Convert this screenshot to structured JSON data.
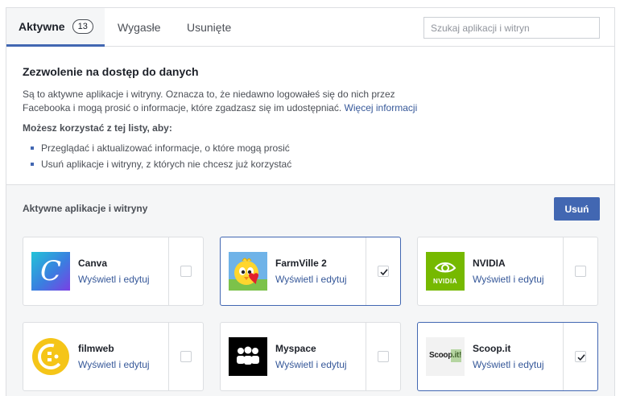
{
  "tabs": {
    "active_label": "Aktywne",
    "active_count": "13",
    "expired_label": "Wygasłe",
    "removed_label": "Usunięte"
  },
  "search": {
    "placeholder": "Szukaj aplikacji i witryn"
  },
  "info": {
    "title": "Zezwolenie na dostęp do danych",
    "description": "Są to aktywne aplikacje i witryny. Oznacza to, że niedawno logowałeś się do nich przez Facebooka i mogą prosić o informacje, które zgadzasz się im udostępniać.",
    "more_link": "Więcej informacji",
    "can_title": "Możesz korzystać z tej listy, aby:",
    "bullets": [
      "Przeglądać i aktualizować informacje, o które mogą prosić",
      "Usuń aplikacje i witryny, z których nie chcesz już korzystać"
    ]
  },
  "apps": {
    "title": "Aktywne aplikacje i witryny",
    "remove_label": "Usuń",
    "items": [
      {
        "name": "Canva",
        "link": "Wyświetl i edytuj",
        "checked": false,
        "logo_text": "C",
        "icon": "canva-logo"
      },
      {
        "name": "FarmVille 2",
        "link": "Wyświetl i edytuj",
        "checked": true,
        "icon": "farmville-chick-logo"
      },
      {
        "name": "NVIDIA",
        "link": "Wyświetl i edytuj",
        "checked": false,
        "logo_text": "NVIDIA",
        "icon": "nvidia-logo"
      },
      {
        "name": "filmweb",
        "link": "Wyświetl i edytuj",
        "checked": false,
        "icon": "filmweb-logo"
      },
      {
        "name": "Myspace",
        "link": "Wyświetl i edytuj",
        "checked": false,
        "icon": "myspace-logo"
      },
      {
        "name": "Scoop.it",
        "link": "Wyświetl i edytuj",
        "checked": true,
        "logo_text": "Scoop.it!",
        "icon": "scoopit-logo"
      }
    ]
  },
  "colors": {
    "accent": "#4267b2",
    "link": "#365899",
    "border": "#dddfe2",
    "section_bg": "#f5f6f7"
  }
}
